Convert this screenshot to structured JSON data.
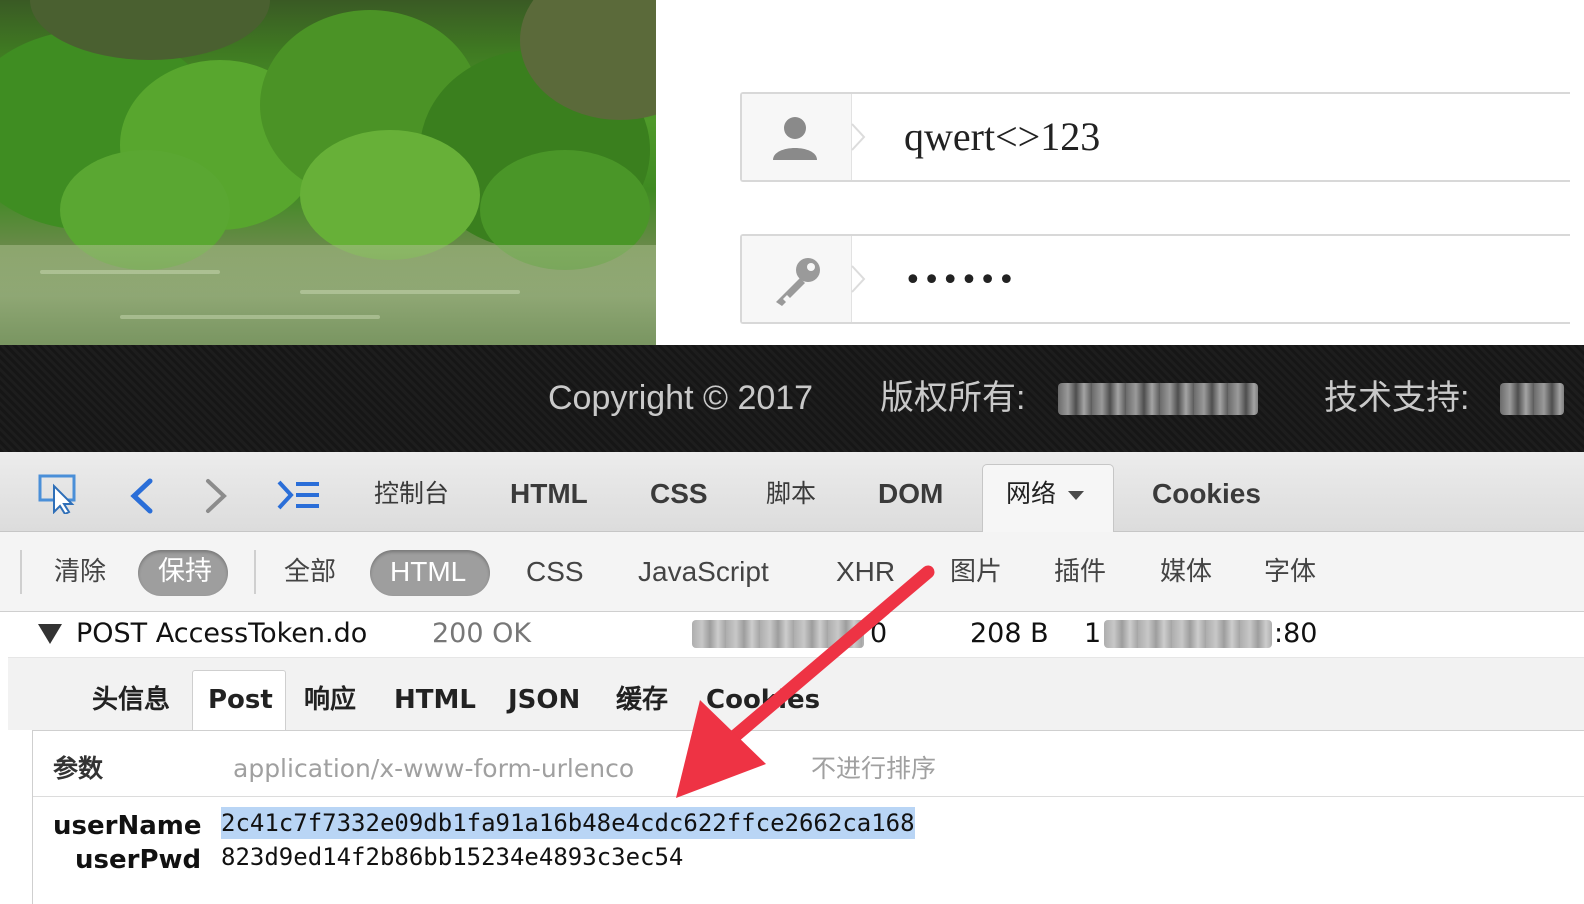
{
  "login": {
    "username_value": "qwert<>123",
    "password_value": "••••••",
    "user_icon": "user-icon",
    "key_icon": "key-icon"
  },
  "footer": {
    "copyright": "Copyright © 2017",
    "rights_label": "版权所有:",
    "support_label": "技术支持:"
  },
  "devtools": {
    "tools": [
      "inspect-icon",
      "back-icon",
      "forward-icon",
      "command-line-icon"
    ],
    "tabs": [
      "控制台",
      "HTML",
      "CSS",
      "脚本",
      "DOM",
      "网络",
      "Cookies"
    ],
    "active_tab": "网络",
    "filters": {
      "clear": "清除",
      "persist": "保持",
      "all": "全部",
      "html": "HTML",
      "css": "CSS",
      "javascript": "JavaScript",
      "xhr": "XHR",
      "images": "图片",
      "plugins": "插件",
      "media": "媒体",
      "fonts": "字体"
    },
    "request": {
      "method_url": "POST AccessToken.do",
      "status": "200 OK",
      "time_partial": "0",
      "size": "208 B",
      "remote_start": "1",
      "remote_end": ":80"
    },
    "subtabs": [
      "头信息",
      "Post",
      "响应",
      "HTML",
      "JSON",
      "缓存",
      "Cookies"
    ],
    "active_subtab": "Post",
    "params": {
      "label": "参数",
      "content_type": "application/x-www-form-urlenco",
      "sort_label": "不进行排序",
      "rows": [
        {
          "key": "userName",
          "value": "2c41c7f7332e09db1fa91a16b48e4cdc622ffce2662ca168"
        },
        {
          "key": "userPwd",
          "value": "823d9ed14f2b86bb15234e4893c3ec54"
        }
      ]
    }
  },
  "colors": {
    "annotation_arrow": "#ee3344",
    "selection": "#b9d5f5",
    "link_blue": "#2a6ed8"
  }
}
